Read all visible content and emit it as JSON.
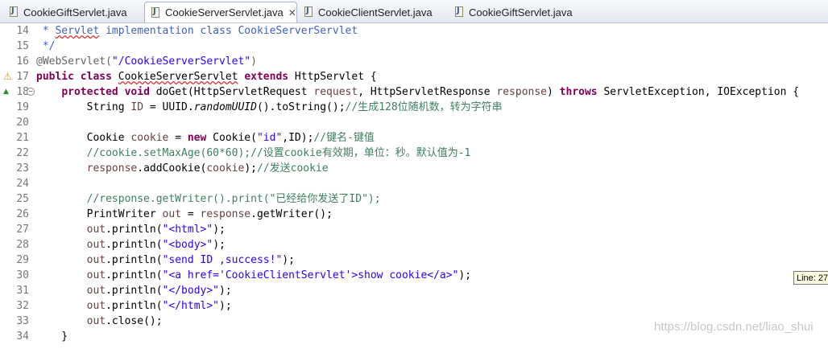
{
  "tabs": [
    {
      "label": "CookieGiftServlet.java"
    },
    {
      "label": "CookieServerServlet.java",
      "close": "✕"
    },
    {
      "label": "CookieClientServlet.java"
    },
    {
      "label": "CookieGiftServlet.java"
    }
  ],
  "lines": [
    {
      "n": "14",
      "segs": [
        {
          "t": " * ",
          "c": "doc-c"
        },
        {
          "t": "Servlet",
          "c": "doc-c sq"
        },
        {
          "t": " implementation class CookieServerServlet",
          "c": "doc-c"
        }
      ]
    },
    {
      "n": "15",
      "segs": [
        {
          "t": " */",
          "c": "doc-c"
        }
      ]
    },
    {
      "n": "16",
      "segs": [
        {
          "t": "@WebServlet(",
          "c": "anno"
        },
        {
          "t": "\"/CookieServerServlet\"",
          "c": "str"
        },
        {
          "t": ")",
          "c": "anno"
        }
      ]
    },
    {
      "n": "17",
      "mark": "warn",
      "segs": [
        {
          "t": "public",
          "c": "kw"
        },
        {
          "t": " "
        },
        {
          "t": "class",
          "c": "kw"
        },
        {
          "t": " "
        },
        {
          "t": "CookieServerServlet",
          "c": "sq"
        },
        {
          "t": " "
        },
        {
          "t": "extends",
          "c": "kw"
        },
        {
          "t": " HttpServlet {"
        }
      ]
    },
    {
      "n": "18",
      "mark": "override",
      "fold": "−",
      "segs": [
        {
          "t": "    "
        },
        {
          "t": "protected",
          "c": "kw"
        },
        {
          "t": " "
        },
        {
          "t": "void",
          "c": "kw"
        },
        {
          "t": " doGet(HttpServletRequest "
        },
        {
          "t": "request",
          "c": "var"
        },
        {
          "t": ", HttpServletResponse "
        },
        {
          "t": "response",
          "c": "var"
        },
        {
          "t": ") "
        },
        {
          "t": "throws",
          "c": "kw"
        },
        {
          "t": " ServletException, IOException {"
        }
      ]
    },
    {
      "n": "19",
      "segs": [
        {
          "t": "        String "
        },
        {
          "t": "ID",
          "c": "var"
        },
        {
          "t": " = UUID."
        },
        {
          "t": "randomUUID",
          "c": "it"
        },
        {
          "t": "().toString();"
        },
        {
          "t": "//生成128位随机数，转为字符串",
          "c": "cm"
        }
      ]
    },
    {
      "n": "20",
      "segs": []
    },
    {
      "n": "21",
      "segs": [
        {
          "t": "        Cookie "
        },
        {
          "t": "cookie",
          "c": "var"
        },
        {
          "t": " = "
        },
        {
          "t": "new",
          "c": "kw"
        },
        {
          "t": " Cookie("
        },
        {
          "t": "\"id\"",
          "c": "str"
        },
        {
          "t": ",ID);"
        },
        {
          "t": "//键名-键值",
          "c": "cm"
        }
      ]
    },
    {
      "n": "22",
      "segs": [
        {
          "t": "        //cookie.setMaxAge(60*60);//设置cookie有效期，单位：秒。默认值为-1",
          "c": "cm"
        }
      ]
    },
    {
      "n": "23",
      "segs": [
        {
          "t": "        "
        },
        {
          "t": "response",
          "c": "var"
        },
        {
          "t": ".addCookie("
        },
        {
          "t": "cookie",
          "c": "var"
        },
        {
          "t": ");"
        },
        {
          "t": "//发送cookie",
          "c": "cm"
        }
      ]
    },
    {
      "n": "24",
      "segs": []
    },
    {
      "n": "25",
      "segs": [
        {
          "t": "        //response.getWriter().print(\"已经给你发送了ID\");",
          "c": "cm"
        }
      ]
    },
    {
      "n": "26",
      "segs": [
        {
          "t": "        PrintWriter "
        },
        {
          "t": "out",
          "c": "var"
        },
        {
          "t": " = "
        },
        {
          "t": "response",
          "c": "var"
        },
        {
          "t": ".getWriter();"
        }
      ]
    },
    {
      "n": "27",
      "segs": [
        {
          "t": "        "
        },
        {
          "t": "out",
          "c": "var"
        },
        {
          "t": ".println("
        },
        {
          "t": "\"<html>\"",
          "c": "str"
        },
        {
          "t": ");"
        }
      ]
    },
    {
      "n": "28",
      "segs": [
        {
          "t": "        "
        },
        {
          "t": "out",
          "c": "var"
        },
        {
          "t": ".println("
        },
        {
          "t": "\"<body>\"",
          "c": "str"
        },
        {
          "t": ");"
        }
      ]
    },
    {
      "n": "29",
      "segs": [
        {
          "t": "        "
        },
        {
          "t": "out",
          "c": "var"
        },
        {
          "t": ".println("
        },
        {
          "t": "\"send ID ,success!\"",
          "c": "str"
        },
        {
          "t": ");"
        }
      ]
    },
    {
      "n": "30",
      "segs": [
        {
          "t": "        "
        },
        {
          "t": "out",
          "c": "var"
        },
        {
          "t": ".println("
        },
        {
          "t": "\"<a href='CookieClientServlet'>show cookie</a>\"",
          "c": "str"
        },
        {
          "t": ");"
        }
      ]
    },
    {
      "n": "31",
      "segs": [
        {
          "t": "        "
        },
        {
          "t": "out",
          "c": "var"
        },
        {
          "t": ".println("
        },
        {
          "t": "\"</body>\"",
          "c": "str"
        },
        {
          "t": ");"
        }
      ]
    },
    {
      "n": "32",
      "segs": [
        {
          "t": "        "
        },
        {
          "t": "out",
          "c": "var"
        },
        {
          "t": ".println("
        },
        {
          "t": "\"</html>\"",
          "c": "str"
        },
        {
          "t": ");"
        }
      ]
    },
    {
      "n": "33",
      "segs": [
        {
          "t": "        "
        },
        {
          "t": "out",
          "c": "var"
        },
        {
          "t": ".close();"
        }
      ]
    },
    {
      "n": "34",
      "segs": [
        {
          "t": "    }"
        }
      ]
    }
  ],
  "tooltip": "Line: 27",
  "watermark": "https://blog.csdn.net/liao_shui",
  "colors": {
    "keyword": "#7f0055",
    "string": "#2a00ff",
    "comment": "#3f7f5f",
    "javadoc": "#3f5fbf",
    "local_var": "#6a3e3e"
  }
}
